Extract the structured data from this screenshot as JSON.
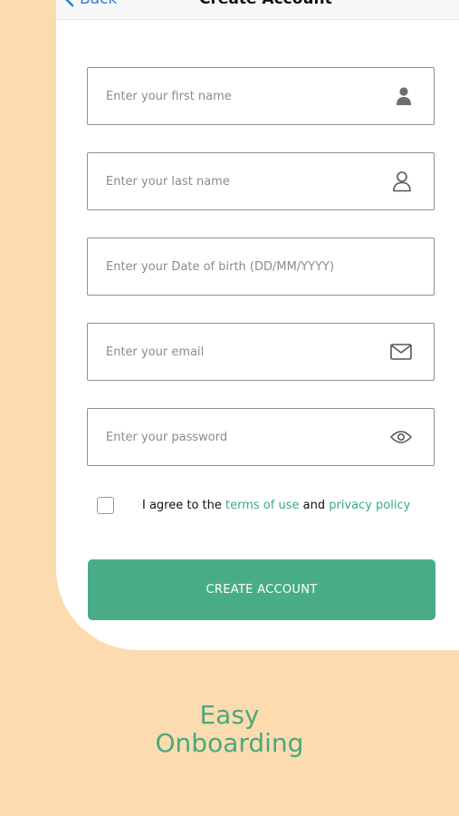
{
  "nav": {
    "back_label": "Back",
    "title": "Create Account"
  },
  "form": {
    "first_name": {
      "placeholder": "Enter your first name",
      "value": "",
      "icon": "user-filled-icon"
    },
    "last_name": {
      "placeholder": "Enter your last name",
      "value": "",
      "icon": "user-outline-icon"
    },
    "dob": {
      "placeholder": "Enter your Date of birth (DD/MM/YYYY)",
      "value": ""
    },
    "email": {
      "placeholder": "Enter your email",
      "value": "",
      "icon": "envelope-icon"
    },
    "password": {
      "placeholder": "Enter your password",
      "value": "",
      "icon": "eye-icon"
    }
  },
  "agreement": {
    "checked": false,
    "prefix": "I agree to the ",
    "terms_link": "terms of use",
    "conjunction": " and ",
    "privacy_link": "privacy policy"
  },
  "cta": {
    "label": "CREATE ACCOUNT"
  },
  "tagline": {
    "line1": "Easy",
    "line2": "Onboarding"
  },
  "colors": {
    "background": "#fcdcae",
    "accent_green": "#48ad87",
    "link_blue": "#2f7de1"
  }
}
